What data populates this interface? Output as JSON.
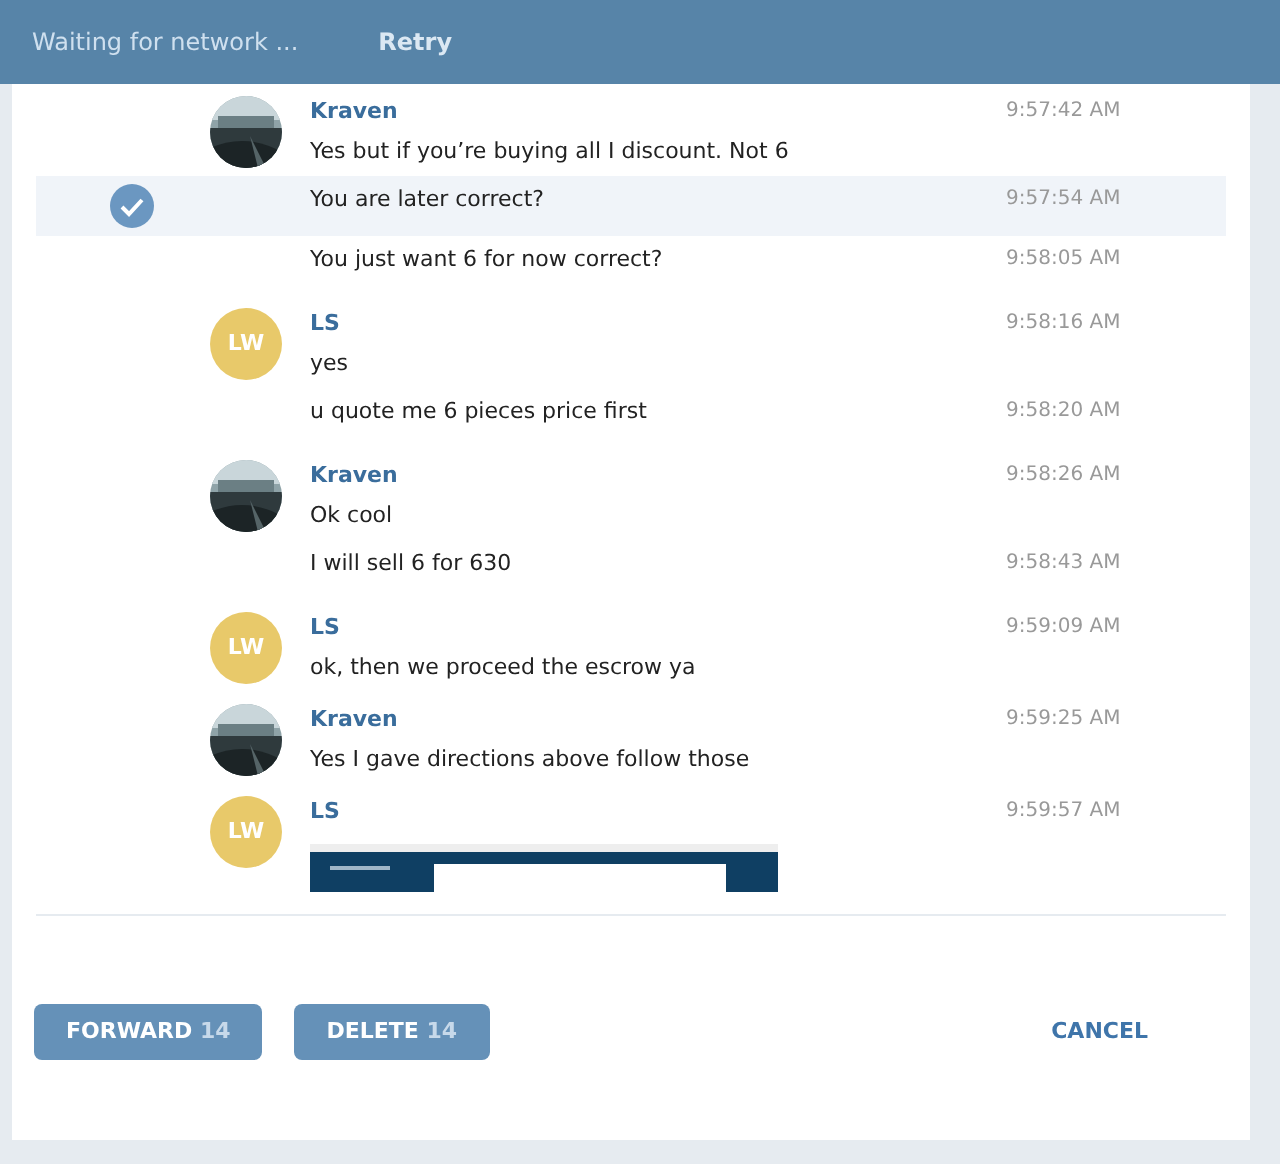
{
  "header": {
    "status": "Waiting for network ...",
    "retry": "Retry"
  },
  "messages": [
    {
      "kind": "first",
      "name": "Kraven",
      "time": "9:57:42 AM",
      "text": "Yes but if you’re buying all I discount. Not 6",
      "selected": false
    },
    {
      "kind": "continuation",
      "time": "9:57:54 AM",
      "text": "You are later correct?",
      "selected": true
    },
    {
      "kind": "continuation",
      "time": "9:58:05 AM",
      "text": "You just want 6 for now correct?",
      "selected": false
    },
    {
      "kind": "first",
      "avatar": {
        "kind": "initials",
        "initials": "LW"
      },
      "name": "LS",
      "time": "9:58:16 AM",
      "text": "yes",
      "selected": false
    },
    {
      "kind": "continuation",
      "time": "9:58:20 AM",
      "text": "u quote me 6 pieces price first",
      "selected": false
    },
    {
      "kind": "first",
      "name": "Kraven",
      "time": "9:58:26 AM",
      "text": "Ok cool",
      "selected": false
    },
    {
      "kind": "continuation",
      "time": "9:58:43 AM",
      "text": "I will sell 6 for 630",
      "selected": false
    },
    {
      "kind": "first",
      "avatar": {
        "kind": "initials",
        "initials": "LW"
      },
      "name": "LS",
      "time": "9:59:09 AM",
      "text": "ok, then we proceed the escrow ya",
      "selected": false
    },
    {
      "kind": "first",
      "name": "Kraven",
      "time": "9:59:25 AM",
      "text": "Yes I gave directions above follow those",
      "selected": false
    },
    {
      "kind": "first",
      "avatar": {
        "kind": "initials",
        "initials": "LW"
      },
      "name": "LS",
      "time": "9:59:57 AM",
      "selected": false
    }
  ],
  "actions": {
    "forward": {
      "label": "FORWARD",
      "count": "14"
    },
    "delete": {
      "label": "DELETE",
      "count": "14"
    },
    "cancel": "CANCEL"
  }
}
